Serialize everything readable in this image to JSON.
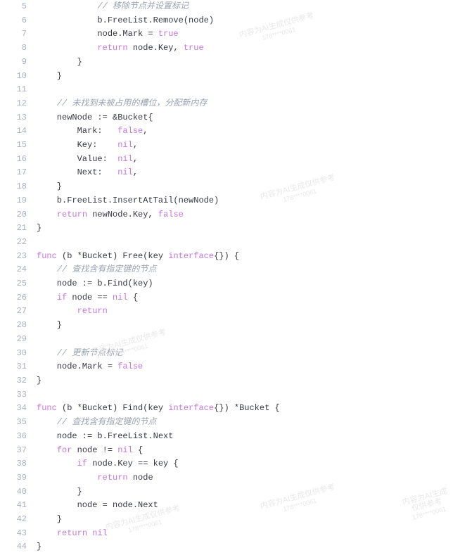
{
  "lines": [
    {
      "n": "5",
      "tokens": [
        {
          "c": "cmt",
          "t": "            // 移除节点并设置标记"
        }
      ]
    },
    {
      "n": "6",
      "tokens": [
        {
          "c": "id",
          "t": "            b.FreeList.Remove(node)"
        }
      ]
    },
    {
      "n": "7",
      "tokens": [
        {
          "c": "id",
          "t": "            node.Mark = "
        },
        {
          "c": "lit",
          "t": "true"
        }
      ]
    },
    {
      "n": "8",
      "tokens": [
        {
          "c": "id",
          "t": "            "
        },
        {
          "c": "kw",
          "t": "return"
        },
        {
          "c": "id",
          "t": " node.Key, "
        },
        {
          "c": "lit",
          "t": "true"
        }
      ]
    },
    {
      "n": "9",
      "tokens": [
        {
          "c": "id",
          "t": "        }"
        }
      ]
    },
    {
      "n": "10",
      "tokens": [
        {
          "c": "id",
          "t": "    }"
        }
      ]
    },
    {
      "n": "11",
      "tokens": []
    },
    {
      "n": "12",
      "tokens": [
        {
          "c": "id",
          "t": "    "
        },
        {
          "c": "cmt",
          "t": "// 未找到未被占用的槽位，分配新内存"
        }
      ]
    },
    {
      "n": "13",
      "tokens": [
        {
          "c": "id",
          "t": "    newNode := &Bucket{"
        }
      ]
    },
    {
      "n": "14",
      "tokens": [
        {
          "c": "id",
          "t": "        Mark:   "
        },
        {
          "c": "lit",
          "t": "false"
        },
        {
          "c": "id",
          "t": ","
        }
      ]
    },
    {
      "n": "15",
      "tokens": [
        {
          "c": "id",
          "t": "        Key:    "
        },
        {
          "c": "lit",
          "t": "nil"
        },
        {
          "c": "id",
          "t": ","
        }
      ]
    },
    {
      "n": "16",
      "tokens": [
        {
          "c": "id",
          "t": "        Value:  "
        },
        {
          "c": "lit",
          "t": "nil"
        },
        {
          "c": "id",
          "t": ","
        }
      ]
    },
    {
      "n": "17",
      "tokens": [
        {
          "c": "id",
          "t": "        Next:   "
        },
        {
          "c": "lit",
          "t": "nil"
        },
        {
          "c": "id",
          "t": ","
        }
      ]
    },
    {
      "n": "18",
      "tokens": [
        {
          "c": "id",
          "t": "    }"
        }
      ]
    },
    {
      "n": "19",
      "tokens": [
        {
          "c": "id",
          "t": "    b.FreeList.InsertAtTail(newNode)"
        }
      ]
    },
    {
      "n": "20",
      "tokens": [
        {
          "c": "id",
          "t": "    "
        },
        {
          "c": "kw",
          "t": "return"
        },
        {
          "c": "id",
          "t": " newNode.Key, "
        },
        {
          "c": "lit",
          "t": "false"
        }
      ]
    },
    {
      "n": "21",
      "tokens": [
        {
          "c": "id",
          "t": "}"
        }
      ]
    },
    {
      "n": "22",
      "tokens": []
    },
    {
      "n": "23",
      "tokens": [
        {
          "c": "kw",
          "t": "func"
        },
        {
          "c": "id",
          "t": " (b *Bucket) Free(key "
        },
        {
          "c": "kw",
          "t": "interface"
        },
        {
          "c": "id",
          "t": "{}) {"
        }
      ]
    },
    {
      "n": "24",
      "tokens": [
        {
          "c": "id",
          "t": "    "
        },
        {
          "c": "cmt",
          "t": "// 查找含有指定键的节点"
        }
      ]
    },
    {
      "n": "25",
      "tokens": [
        {
          "c": "id",
          "t": "    node := b.Find(key)"
        }
      ]
    },
    {
      "n": "26",
      "tokens": [
        {
          "c": "id",
          "t": "    "
        },
        {
          "c": "kw",
          "t": "if"
        },
        {
          "c": "id",
          "t": " node == "
        },
        {
          "c": "lit",
          "t": "nil"
        },
        {
          "c": "id",
          "t": " {"
        }
      ]
    },
    {
      "n": "27",
      "tokens": [
        {
          "c": "id",
          "t": "        "
        },
        {
          "c": "kw",
          "t": "return"
        }
      ]
    },
    {
      "n": "28",
      "tokens": [
        {
          "c": "id",
          "t": "    }"
        }
      ]
    },
    {
      "n": "29",
      "tokens": []
    },
    {
      "n": "30",
      "tokens": [
        {
          "c": "id",
          "t": "    "
        },
        {
          "c": "cmt",
          "t": "// 更新节点标记"
        }
      ]
    },
    {
      "n": "31",
      "tokens": [
        {
          "c": "id",
          "t": "    node.Mark = "
        },
        {
          "c": "lit",
          "t": "false"
        }
      ]
    },
    {
      "n": "32",
      "tokens": [
        {
          "c": "id",
          "t": "}"
        }
      ]
    },
    {
      "n": "33",
      "tokens": []
    },
    {
      "n": "34",
      "tokens": [
        {
          "c": "kw",
          "t": "func"
        },
        {
          "c": "id",
          "t": " (b *Bucket) Find(key "
        },
        {
          "c": "kw",
          "t": "interface"
        },
        {
          "c": "id",
          "t": "{}) *Bucket {"
        }
      ]
    },
    {
      "n": "35",
      "tokens": [
        {
          "c": "id",
          "t": "    "
        },
        {
          "c": "cmt",
          "t": "// 查找含有指定键的节点"
        }
      ]
    },
    {
      "n": "36",
      "tokens": [
        {
          "c": "id",
          "t": "    node := b.FreeList.Next"
        }
      ]
    },
    {
      "n": "37",
      "tokens": [
        {
          "c": "id",
          "t": "    "
        },
        {
          "c": "kw",
          "t": "for"
        },
        {
          "c": "id",
          "t": " node != "
        },
        {
          "c": "lit",
          "t": "nil"
        },
        {
          "c": "id",
          "t": " {"
        }
      ]
    },
    {
      "n": "38",
      "tokens": [
        {
          "c": "id",
          "t": "        "
        },
        {
          "c": "kw",
          "t": "if"
        },
        {
          "c": "id",
          "t": " node.Key == key {"
        }
      ]
    },
    {
      "n": "39",
      "tokens": [
        {
          "c": "id",
          "t": "            "
        },
        {
          "c": "kw",
          "t": "return"
        },
        {
          "c": "id",
          "t": " node"
        }
      ]
    },
    {
      "n": "40",
      "tokens": [
        {
          "c": "id",
          "t": "        }"
        }
      ]
    },
    {
      "n": "41",
      "tokens": [
        {
          "c": "id",
          "t": "        node = node.Next"
        }
      ]
    },
    {
      "n": "42",
      "tokens": [
        {
          "c": "id",
          "t": "    }"
        }
      ]
    },
    {
      "n": "43",
      "tokens": [
        {
          "c": "id",
          "t": "    "
        },
        {
          "c": "kw",
          "t": "return"
        },
        {
          "c": "id",
          "t": " "
        },
        {
          "c": "lit",
          "t": "nil"
        }
      ]
    },
    {
      "n": "44",
      "tokens": [
        {
          "c": "id",
          "t": "}"
        }
      ]
    }
  ],
  "watermark": {
    "text1": "内容为AI生成仅供参考",
    "text2": "178****0061"
  }
}
